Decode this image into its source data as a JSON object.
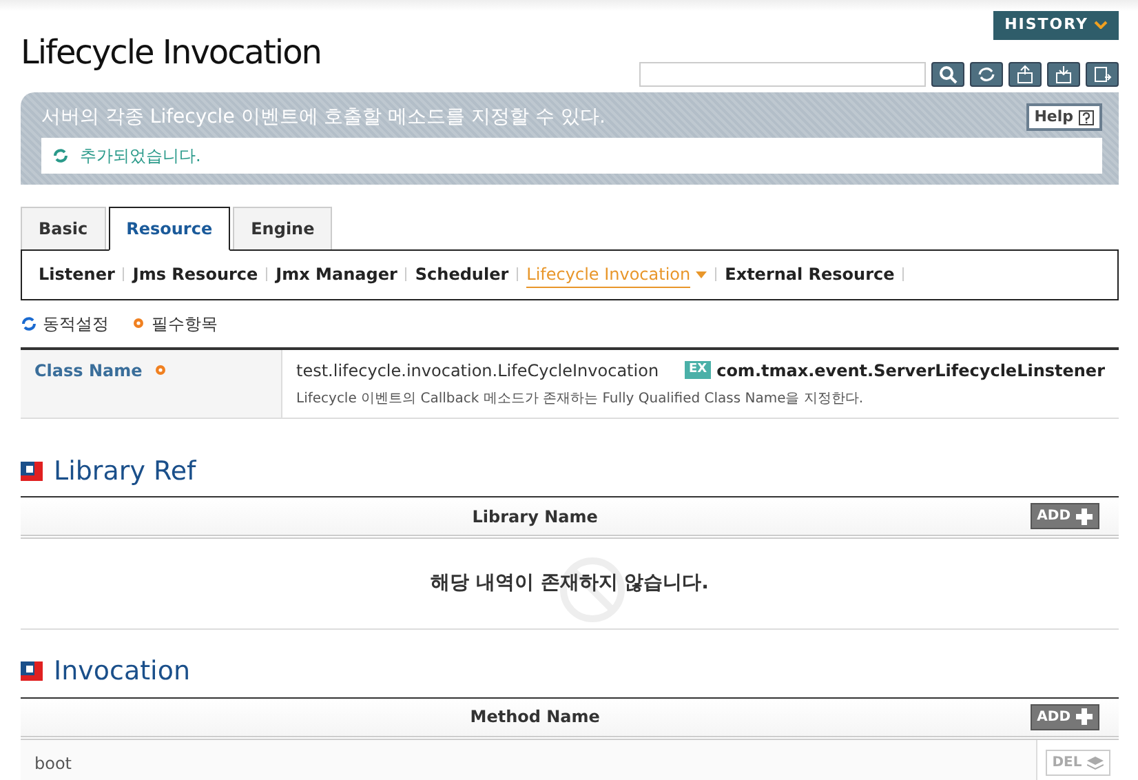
{
  "page": {
    "title": "Lifecycle Invocation",
    "history_button": "HISTORY"
  },
  "banner": {
    "description": "서버의 각종 Lifecycle 이벤트에 호출할 메소드를 지정할 수 있다.",
    "help_button": "Help",
    "message": "추가되었습니다."
  },
  "tabs": [
    {
      "label": "Basic",
      "selected": false
    },
    {
      "label": "Resource",
      "selected": true
    },
    {
      "label": "Engine",
      "selected": false
    }
  ],
  "subtabs": [
    {
      "label": "Listener",
      "selected": false
    },
    {
      "label": "Jms Resource",
      "selected": false
    },
    {
      "label": "Jmx Manager",
      "selected": false
    },
    {
      "label": "Scheduler",
      "selected": false
    },
    {
      "label": "Lifecycle Invocation",
      "selected": true
    },
    {
      "label": "External Resource",
      "selected": false
    }
  ],
  "legend": [
    {
      "kind": "dynamic",
      "label": "동적설정"
    },
    {
      "kind": "required",
      "label": "필수항목"
    }
  ],
  "fields": [
    {
      "label": "Class Name",
      "required": true,
      "value": "test.lifecycle.invocation.LifeCycleInvocation",
      "example_badge": "EX",
      "example": "com.tmax.event.ServerLifecycleLinstener",
      "description": "Lifecycle 이벤트의 Callback 메소드가 존재하는 Fully Qualified Class Name을 지정한다."
    }
  ],
  "sections": [
    {
      "title": "Library Ref",
      "column": "Library Name",
      "add_button": "ADD",
      "empty_text": "해당 내역이 존재하지 않습니다."
    },
    {
      "title": "Invocation",
      "column": "Method Name",
      "add_button": "ADD",
      "rows": [
        {
          "name": "boot",
          "delete_button": "DEL"
        }
      ]
    }
  ]
}
